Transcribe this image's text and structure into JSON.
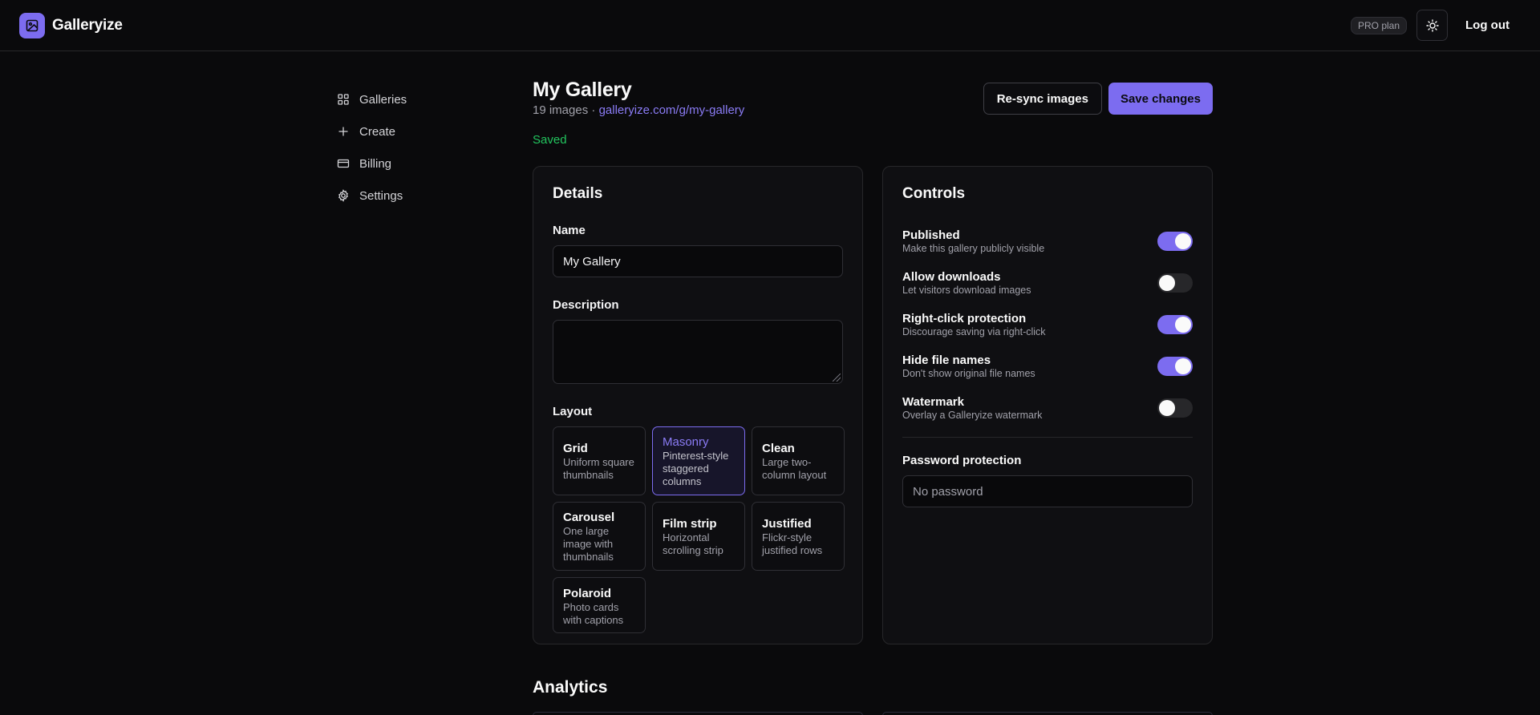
{
  "app": {
    "name": "Galleryize"
  },
  "header": {
    "plan_badge": "PRO plan",
    "logout": "Log out"
  },
  "sidebar": {
    "items": [
      {
        "label": "Galleries",
        "icon": "grid-icon"
      },
      {
        "label": "Create",
        "icon": "plus-icon"
      },
      {
        "label": "Billing",
        "icon": "credit-card-icon"
      },
      {
        "label": "Settings",
        "icon": "gear-icon"
      }
    ]
  },
  "page": {
    "title": "My Gallery",
    "image_count": "19 images",
    "separator": "·",
    "url": "galleryize.com/g/my-gallery",
    "resync_label": "Re-sync images",
    "save_label": "Save changes",
    "status": "Saved"
  },
  "details": {
    "title": "Details",
    "name_label": "Name",
    "name_value": "My Gallery",
    "description_label": "Description",
    "description_value": "",
    "layout_label": "Layout",
    "selected_layout": "Masonry",
    "layouts": [
      {
        "name": "Grid",
        "desc": "Uniform square thumbnails"
      },
      {
        "name": "Masonry",
        "desc": "Pinterest-style staggered columns"
      },
      {
        "name": "Clean",
        "desc": "Large two-column layout"
      },
      {
        "name": "Carousel",
        "desc": "One large image with thumbnails"
      },
      {
        "name": "Film strip",
        "desc": "Horizontal scrolling strip"
      },
      {
        "name": "Justified",
        "desc": "Flickr-style justified rows"
      },
      {
        "name": "Polaroid",
        "desc": "Photo cards with captions"
      }
    ]
  },
  "controls": {
    "title": "Controls",
    "items": [
      {
        "name": "Published",
        "desc": "Make this gallery publicly visible",
        "on": true
      },
      {
        "name": "Allow downloads",
        "desc": "Let visitors download images",
        "on": false
      },
      {
        "name": "Right-click protection",
        "desc": "Discourage saving via right-click",
        "on": true
      },
      {
        "name": "Hide file names",
        "desc": "Don't show original file names",
        "on": true
      },
      {
        "name": "Watermark",
        "desc": "Overlay a Galleryize watermark",
        "on": false
      }
    ],
    "password_label": "Password protection",
    "password_placeholder": "No password"
  },
  "analytics": {
    "title": "Analytics"
  },
  "colors": {
    "accent": "#7c6cf0",
    "success": "#22c55e",
    "background": "#0a0a0c"
  }
}
